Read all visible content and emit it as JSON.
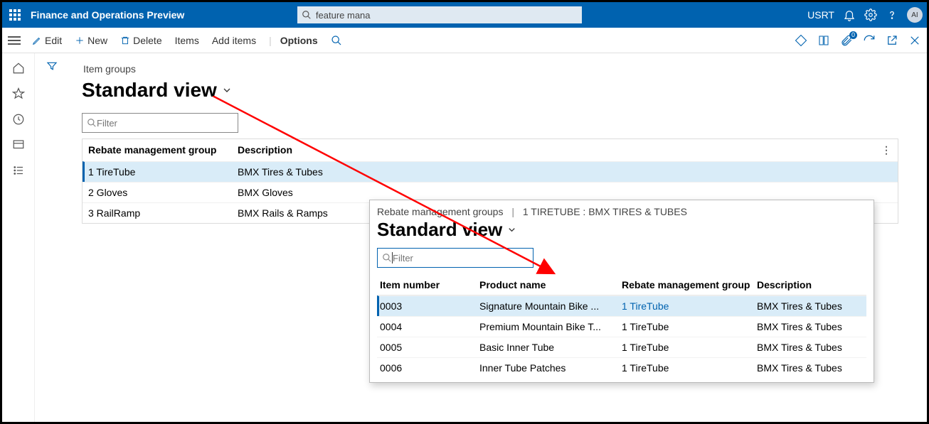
{
  "header": {
    "app_title": "Finance and Operations Preview",
    "search_value": "feature mana",
    "user_code": "USRT",
    "avatar": "AI"
  },
  "actions": {
    "edit": "Edit",
    "new": "New",
    "delete": "Delete",
    "items": "Items",
    "add_items": "Add items",
    "options": "Options",
    "badge_count": "0"
  },
  "page": {
    "title": "Item groups",
    "view": "Standard view",
    "filter_placeholder": "Filter",
    "columns": {
      "group": "Rebate management group",
      "desc": "Description"
    },
    "rows": [
      {
        "group": "1 TireTube",
        "desc": "BMX Tires & Tubes",
        "selected": true
      },
      {
        "group": "2 Gloves",
        "desc": "BMX Gloves",
        "selected": false
      },
      {
        "group": "3 RailRamp",
        "desc": "BMX Rails & Ramps",
        "selected": false
      }
    ]
  },
  "popup": {
    "crumbs_parent": "Rebate management groups",
    "crumbs_current": "1 TIRETUBE : BMX TIRES & TUBES",
    "view": "Standard view",
    "filter_placeholder": "Filter",
    "columns": {
      "item": "Item number",
      "product": "Product name",
      "group": "Rebate management group",
      "desc": "Description"
    },
    "rows": [
      {
        "item": "0003",
        "product": "Signature Mountain Bike ...",
        "group": "1 TireTube",
        "desc": "BMX Tires & Tubes",
        "selected": true
      },
      {
        "item": "0004",
        "product": "Premium Mountain Bike T...",
        "group": "1 TireTube",
        "desc": "BMX Tires & Tubes",
        "selected": false
      },
      {
        "item": "0005",
        "product": "Basic Inner Tube",
        "group": "1 TireTube",
        "desc": "BMX Tires & Tubes",
        "selected": false
      },
      {
        "item": "0006",
        "product": "Inner Tube Patches",
        "group": "1 TireTube",
        "desc": "BMX Tires & Tubes",
        "selected": false
      }
    ]
  }
}
